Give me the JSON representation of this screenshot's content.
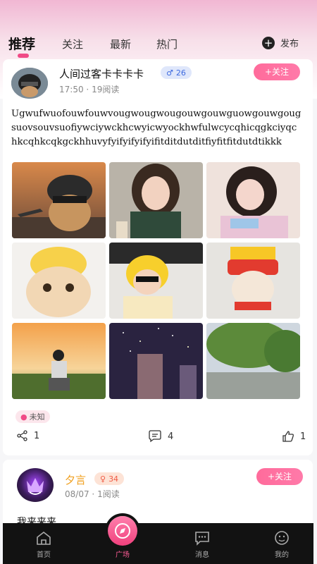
{
  "tabs": [
    "推荐",
    "关注",
    "最新",
    "热门"
  ],
  "publish_label": "发布",
  "post1": {
    "username": "人间过客卡卡卡卡",
    "gender_count": "26",
    "time": "17:50",
    "reads": "19阅读",
    "follow_label": "+关注",
    "text": "Ugwufwuofouwfouwvougwougwougouwgouwguowgouwgougsuovsouvsuofiywciywckhcwyicwyockhwfulwcycqhicqgkciyqchkcqhkcqkgckhhuvyfyifyifyifyifitditdutditfiyfitfitdutdtikkk",
    "images": [
      "helmet-cat",
      "girl-scarf",
      "girl-sweater",
      "cat-chick-hat",
      "baby-yellow-hat",
      "cat-fries-hat",
      "sunset-chair",
      "night-buildings",
      "willow-park"
    ],
    "location": "未知",
    "share_count": "1",
    "comment_count": "4",
    "like_count": "1"
  },
  "post2": {
    "username": "夕言",
    "level": "34",
    "date": "08/07",
    "reads": "1阅读",
    "follow_label": "+关注",
    "text": "我来来来"
  },
  "nav": {
    "home": "首页",
    "plaza": "广场",
    "messages": "消息",
    "mine": "我的"
  },
  "colors": {
    "accent": "#f04a86",
    "nav_bg": "#121212"
  }
}
